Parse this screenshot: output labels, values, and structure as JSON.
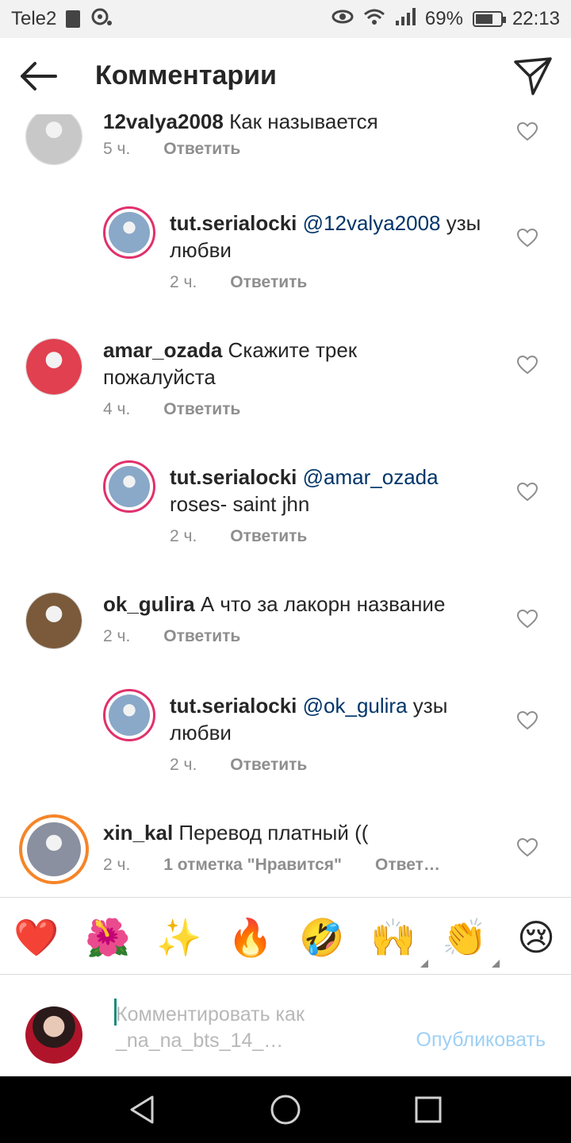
{
  "status_bar": {
    "carrier": "Tele2",
    "battery": "69%",
    "battery_level": 0.69,
    "time": "22:13"
  },
  "header": {
    "title": "Комментарии",
    "back_icon": "arrow-left-icon",
    "send_icon": "paper-plane-icon"
  },
  "comments": [
    {
      "username": "12valya2008",
      "mention": "",
      "text": "Как называется",
      "text2": "",
      "age": "5 ч.",
      "likes": "",
      "reply": "Ответить",
      "avatar_color": "#c8c8c8"
    },
    {
      "username": "tut.serialocki",
      "mention": "@12valya2008",
      "text": "узы",
      "text2": "любви",
      "age": "2 ч.",
      "likes": "",
      "reply": "Ответить",
      "avatar_color": "#8aa8c8"
    },
    {
      "username": "amar_ozada",
      "mention": "",
      "text": "Скажите трек",
      "text2": "пожалуйста",
      "age": "4 ч.",
      "likes": "",
      "reply": "Ответить",
      "avatar_color": "#e04050"
    },
    {
      "username": "tut.serialocki",
      "mention": "@amar_ozada",
      "text": "",
      "text2": "roses- saint jhn",
      "age": "2 ч.",
      "likes": "",
      "reply": "Ответить",
      "avatar_color": "#8aa8c8"
    },
    {
      "username": "ok_gulira",
      "mention": "",
      "text": "А что за лакорн название",
      "text2": "",
      "age": "2 ч.",
      "likes": "",
      "reply": "Ответить",
      "avatar_color": "#7a5a3a"
    },
    {
      "username": "tut.serialocki",
      "mention": "@ok_gulira",
      "text": "узы",
      "text2": "любви",
      "age": "2 ч.",
      "likes": "",
      "reply": "Ответить",
      "avatar_color": "#8aa8c8"
    },
    {
      "username": "xin_kal",
      "mention": "",
      "text": "Перевод платный ((",
      "text2": "",
      "age": "2 ч.",
      "likes": "1 отметка \"Нравится\"",
      "reply": "Ответ…",
      "avatar_color": "#8a90a0"
    }
  ],
  "emoji_bar": [
    {
      "glyph": "❤️",
      "name": "red-heart-emoji"
    },
    {
      "glyph": "🌺",
      "name": "hibiscus-emoji"
    },
    {
      "glyph": "✨",
      "name": "sparkles-emoji"
    },
    {
      "glyph": "🔥",
      "name": "fire-emoji"
    },
    {
      "glyph": "🤣",
      "name": "rofl-emoji"
    },
    {
      "glyph": "🙌",
      "name": "raising-hands-emoji"
    },
    {
      "glyph": "👏",
      "name": "clapping-hands-emoji"
    },
    {
      "glyph": "😢",
      "name": "crying-face-emoji"
    }
  ],
  "compose": {
    "placeholder": "Комментировать как _na_na_bts_14_…",
    "publish_label": "Опубликовать"
  },
  "colors": {
    "mention": "#003569",
    "meta": "#8e8e8e",
    "publish_disabled": "#9fd0f4"
  }
}
